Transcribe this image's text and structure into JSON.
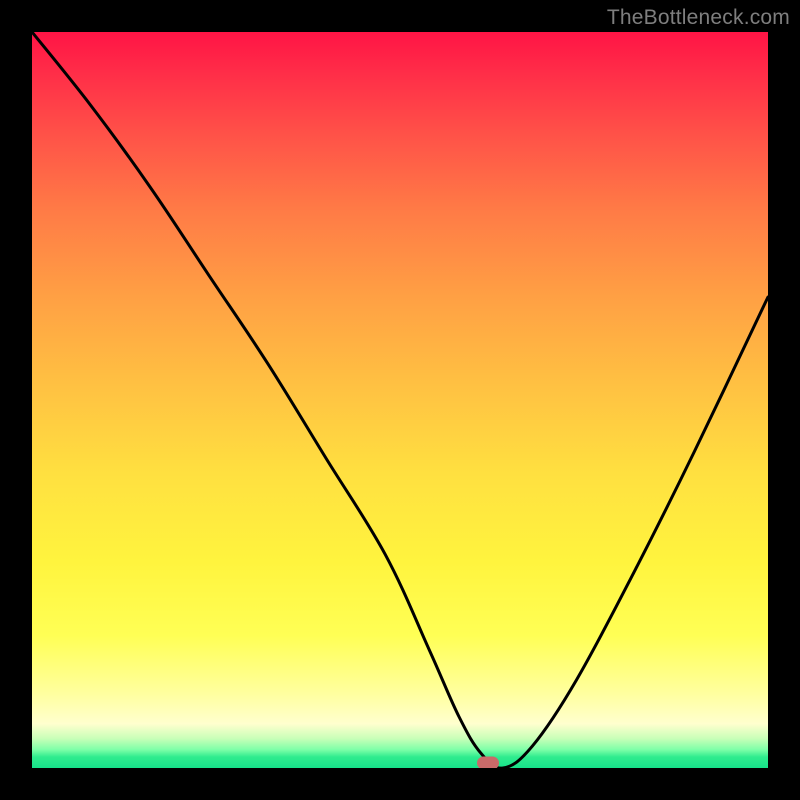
{
  "watermark": "TheBottleneck.com",
  "chart_data": {
    "type": "line",
    "title": "",
    "xlabel": "",
    "ylabel": "",
    "xlim": [
      0,
      100
    ],
    "ylim": [
      0,
      100
    ],
    "series": [
      {
        "name": "bottleneck-curve",
        "x": [
          0,
          8,
          16,
          24,
          32,
          40,
          48,
          54,
          58,
          61,
          64,
          68,
          74,
          82,
          90,
          100
        ],
        "values": [
          100,
          90,
          79,
          67,
          55,
          42,
          29,
          16,
          7,
          2,
          0,
          3,
          12,
          27,
          43,
          64
        ]
      }
    ],
    "marker": {
      "x": 62,
      "y": 0,
      "name": "optimal-point"
    },
    "background_gradient": {
      "top": "#ff1445",
      "mid": "#ffe040",
      "bottom": "#17e28a"
    }
  }
}
